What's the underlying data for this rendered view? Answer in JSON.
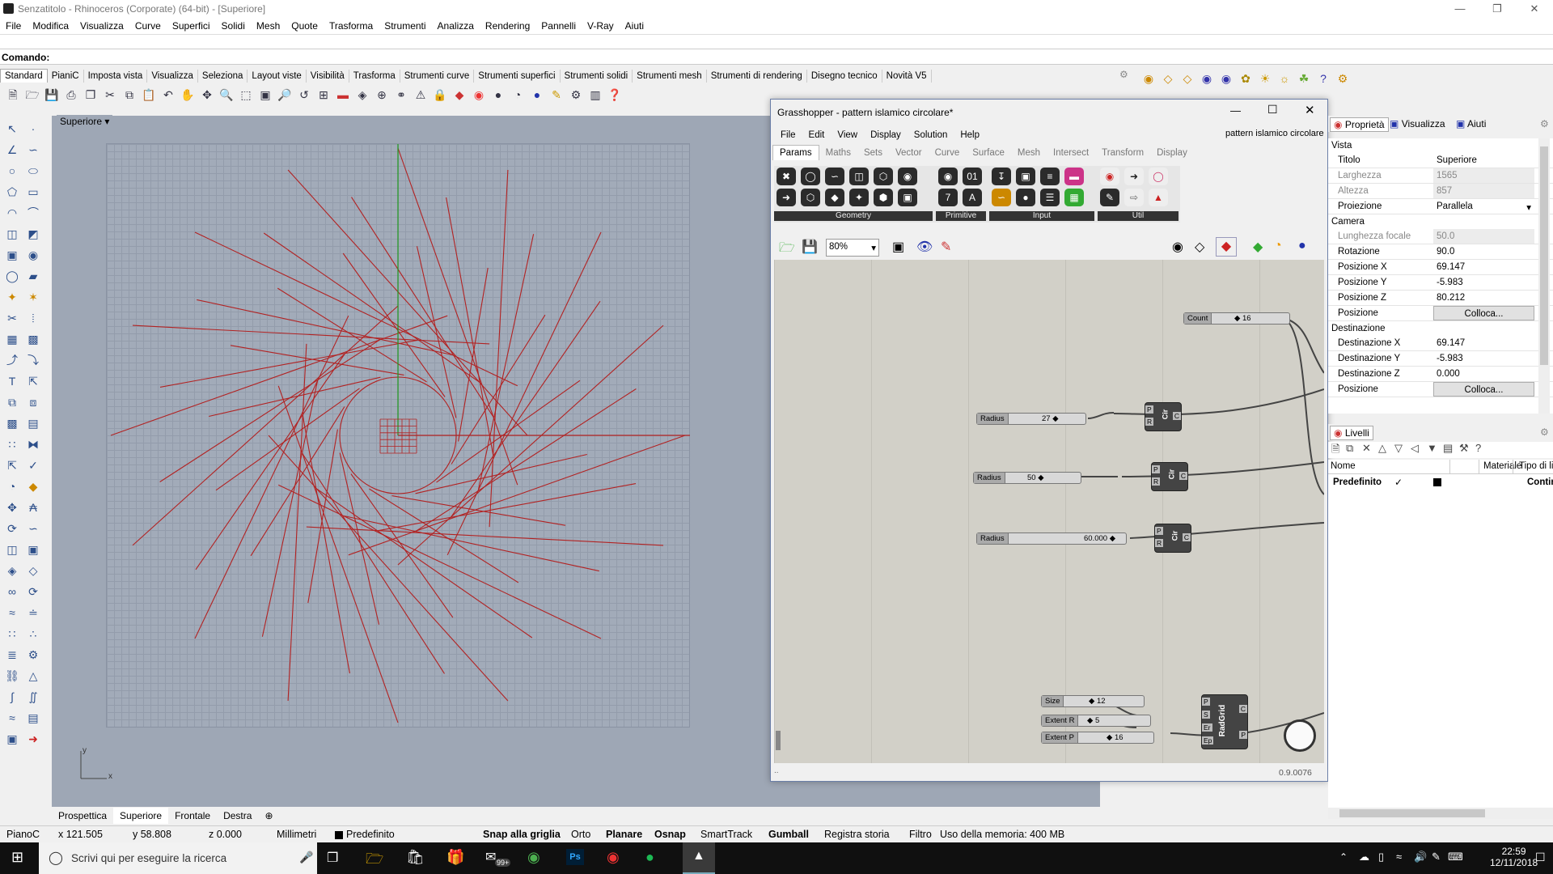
{
  "window": {
    "title": "Senzatitolo - Rhinoceros (Corporate) (64-bit) - [Superiore]"
  },
  "menu": [
    "File",
    "Modifica",
    "Visualizza",
    "Curve",
    "Superfici",
    "Solidi",
    "Mesh",
    "Quote",
    "Trasforma",
    "Strumenti",
    "Analizza",
    "Rendering",
    "Pannelli",
    "V-Ray",
    "Aiuti"
  ],
  "command": {
    "label": "Comando:"
  },
  "toolbar_tabs": [
    "Standard",
    "PianiC",
    "Imposta vista",
    "Visualizza",
    "Seleziona",
    "Layout viste",
    "Visibilità",
    "Trasforma",
    "Strumenti curve",
    "Strumenti superfici",
    "Strumenti solidi",
    "Strumenti mesh",
    "Strumenti di rendering",
    "Disegno tecnico",
    "Novità V5"
  ],
  "viewport": {
    "name": "Superiore",
    "axis_y": "y",
    "axis_x": "x"
  },
  "viewport_tabs": [
    "Prospettica",
    "Superiore",
    "Frontale",
    "Destra"
  ],
  "status": {
    "plane": "PianoC",
    "x": "x 121.505",
    "y": "y 58.808",
    "z": "z 0.000",
    "units": "Millimetri",
    "layer": "Predefinito",
    "snap": "Snap alla griglia",
    "ortho": "Orto",
    "planar": "Planare",
    "osnap": "Osnap",
    "smarttrack": "SmartTrack",
    "gumball": "Gumball",
    "history": "Registra storia",
    "filter": "Filtro",
    "memory": "Uso della memoria: 400 MB"
  },
  "taskbar": {
    "search_placeholder": "Scrivi qui per eseguire la ricerca",
    "time": "22:59",
    "date": "12/11/2018",
    "badge": "99+"
  },
  "grasshopper": {
    "title": "Grasshopper - pattern islamico circolare*",
    "doc_name": "pattern islamico circolare",
    "menu": [
      "File",
      "Edit",
      "View",
      "Display",
      "Solution",
      "Help"
    ],
    "tabs": [
      "Params",
      "Maths",
      "Sets",
      "Vector",
      "Curve",
      "Surface",
      "Mesh",
      "Intersect",
      "Transform",
      "Display"
    ],
    "categories": [
      "Geometry",
      "Primitive",
      "Input",
      "Util"
    ],
    "zoom": "80%",
    "version": "0.9.0076",
    "sliders": [
      {
        "label": "Count",
        "value": "16"
      },
      {
        "label": "Radius",
        "value": "27"
      },
      {
        "label": "Radius",
        "value": "50"
      },
      {
        "label": "Radius",
        "value": "60.000"
      },
      {
        "label": "Size",
        "value": "12"
      },
      {
        "label": "Extent R",
        "value": "5"
      },
      {
        "label": "Extent P",
        "value": "16"
      }
    ],
    "comp_cir": {
      "name": "Cir",
      "in1": "P",
      "in2": "R",
      "out": "C"
    },
    "comp_radgrid": {
      "name": "RadGrid",
      "ins": [
        "P",
        "S",
        "Er",
        "Ep"
      ],
      "outs": [
        "C",
        "P"
      ]
    }
  },
  "properties": {
    "tabs": [
      "Proprietà",
      "Visualizza",
      "Aiuti"
    ],
    "section_vista": "Vista",
    "rows_vista": [
      {
        "k": "Titolo",
        "v": "Superiore"
      },
      {
        "k": "Larghezza",
        "v": "1565"
      },
      {
        "k": "Altezza",
        "v": "857"
      },
      {
        "k": "Proiezione",
        "v": "Parallela"
      }
    ],
    "section_camera": "Camera",
    "rows_camera": [
      {
        "k": "Lunghezza focale",
        "v": "50.0"
      },
      {
        "k": "Rotazione",
        "v": "90.0"
      },
      {
        "k": "Posizione X",
        "v": "69.147"
      },
      {
        "k": "Posizione Y",
        "v": "-5.983"
      },
      {
        "k": "Posizione Z",
        "v": "80.212"
      },
      {
        "k": "Posizione",
        "v": "Colloca..."
      }
    ],
    "section_dest": "Destinazione",
    "rows_dest": [
      {
        "k": "Destinazione X",
        "v": "69.147"
      },
      {
        "k": "Destinazione Y",
        "v": "-5.983"
      },
      {
        "k": "Destinazione Z",
        "v": "0.000"
      },
      {
        "k": "Posizione",
        "v": "Colloca..."
      }
    ]
  },
  "layers": {
    "tab": "Livelli",
    "cols": [
      "Nome",
      "Materiale",
      "Tipo di line"
    ],
    "row": {
      "name": "Predefinito",
      "check": "✓",
      "linetype": "Continuo"
    }
  }
}
